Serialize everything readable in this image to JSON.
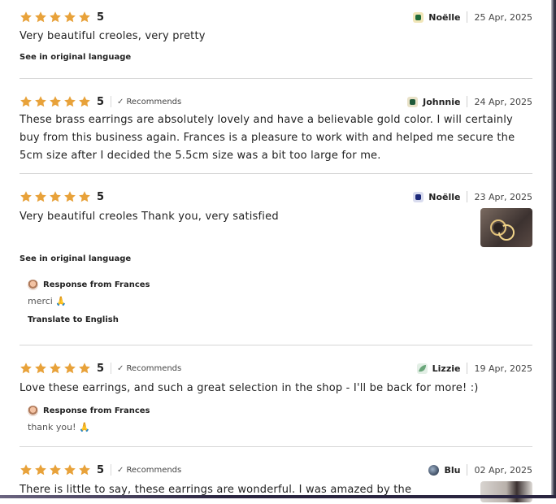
{
  "reviews": [
    {
      "rating": "5",
      "recommends": null,
      "reviewer": "Noëlle",
      "date": "25 Apr, 2025",
      "text": "Very beautiful creoles, very pretty",
      "see_original": "See in original language"
    },
    {
      "rating": "5",
      "recommends": "Recommends",
      "reviewer": "Johnnie",
      "date": "24 Apr, 2025",
      "text": "These brass earrings are absolutely lovely and have a believable gold color. I will certainly buy from this business again. Frances is a pleasure to work with and helped me secure the 5cm size after I decided the 5.5cm size was a bit too large for me."
    },
    {
      "rating": "5",
      "recommends": null,
      "reviewer": "Noëlle",
      "date": "23 Apr, 2025",
      "text": "Very beautiful creoles Thank you, very satisfied",
      "see_original": "See in original language",
      "response_title": "Response from Frances",
      "response_text": "merci 🙏",
      "translate": "Translate to English"
    },
    {
      "rating": "5",
      "recommends": "Recommends",
      "reviewer": "Lizzie",
      "date": "19 Apr, 2025",
      "text": "Love these earrings, and such a great selection in the shop - I'll be back for more! :)",
      "response_title": "Response from Frances",
      "response_text": "thank you! 🙏"
    },
    {
      "rating": "5",
      "recommends": "Recommends",
      "reviewer": "Blu",
      "date": "02 Apr, 2025",
      "text": "There is little to say, these earrings are wonderful. I was amazed by the"
    }
  ],
  "colors": {
    "star": "#E8A23A",
    "divider": "#D6D6D6",
    "text": "#222222"
  },
  "icons": {
    "star": "star-icon",
    "check": "checkmark-icon"
  }
}
